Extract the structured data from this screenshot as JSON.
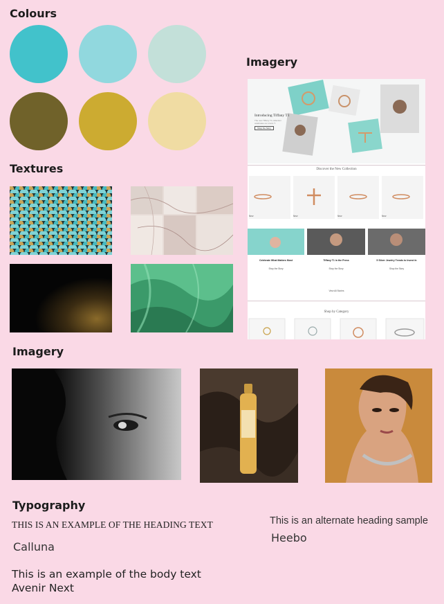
{
  "colours": {
    "title": "Colours",
    "swatches": [
      "#42c2cb",
      "#91d8de",
      "#c3e0d9",
      "#70622a",
      "#ccab31",
      "#f0dca3"
    ]
  },
  "textures": {
    "title": "Textures",
    "items": [
      "teal-scale-texture",
      "marble-tile-texture",
      "gold-dust-texture",
      "green-satin-texture"
    ]
  },
  "imagery_top": {
    "title": "Imagery",
    "site": {
      "hero_title": "Introducing Tiffany T1",
      "hero_text": "The new Tiffany T1 collection celebrates our iconic T.",
      "hero_button": "Shop the Story",
      "collection_title": "Discover the New Collection",
      "products": [
        "New",
        "New",
        "New",
        "New"
      ],
      "stories": [
        {
          "title": "Celebrate What Matters Most",
          "link": "Shop the Story"
        },
        {
          "title": "Tiffany T1 in the Press",
          "link": "Shop the Story"
        },
        {
          "title": "5 Silver Jewelry Trends to Invest In",
          "link": "Shop the Story"
        }
      ],
      "more_label": "View All Stories",
      "category_title": "Shop by Category"
    }
  },
  "imagery_bottom": {
    "title": "Imagery",
    "items": [
      "face-closeup-photo",
      "pantene-bottle-photo",
      "model-portrait-photo"
    ]
  },
  "typography": {
    "title": "Typography",
    "heading_sample": "THIS IS AN EXAMPLE OF THE HEADING TEXT",
    "heading_font": "Calluna",
    "alt_sample": "This is an alternate heading sample",
    "alt_font": "Heebo",
    "body_sample": "This is an example of the body text",
    "body_font": "Avenir Next"
  }
}
